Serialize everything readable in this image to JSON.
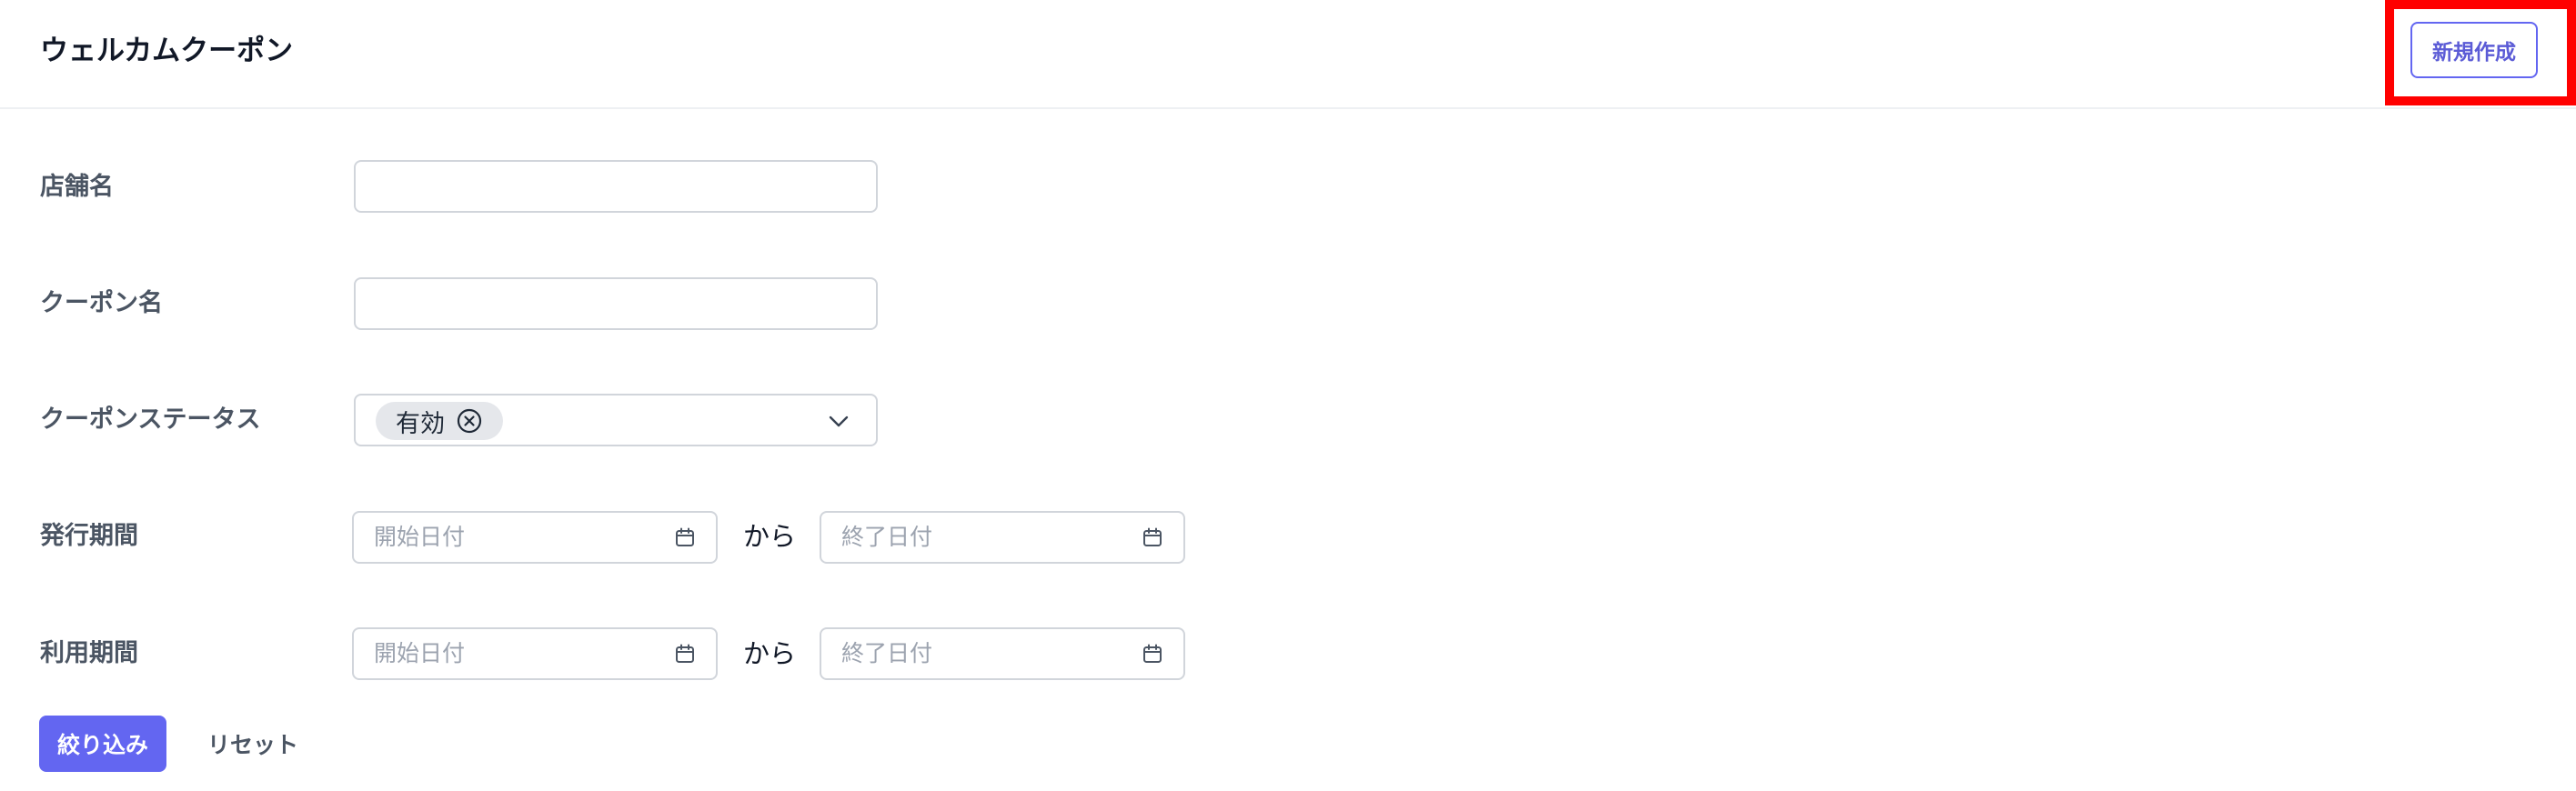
{
  "header": {
    "title": "ウェルカムクーポン",
    "new_button_label": "新規作成"
  },
  "filters": {
    "store_name": {
      "label": "店舗名",
      "value": ""
    },
    "coupon_name": {
      "label": "クーポン名",
      "value": ""
    },
    "coupon_status": {
      "label": "クーポンステータス",
      "selected_chips": [
        "有効"
      ],
      "icons": {
        "chip_remove": "circle-x-icon",
        "dropdown": "chevron-down-icon"
      }
    },
    "issue_period": {
      "label": "発行期間",
      "start_placeholder": "開始日付",
      "separator": "から",
      "end_placeholder": "終了日付"
    },
    "usage_period": {
      "label": "利用期間",
      "start_placeholder": "開始日付",
      "separator": "から",
      "end_placeholder": "終了日付"
    }
  },
  "actions": {
    "filter_label": "絞り込み",
    "reset_label": "リセット"
  },
  "colors": {
    "accent": "#6366f1",
    "highlight": "#ff0000",
    "label": "#4b5563",
    "border": "#d1d5db",
    "placeholder": "#9ca3af"
  }
}
